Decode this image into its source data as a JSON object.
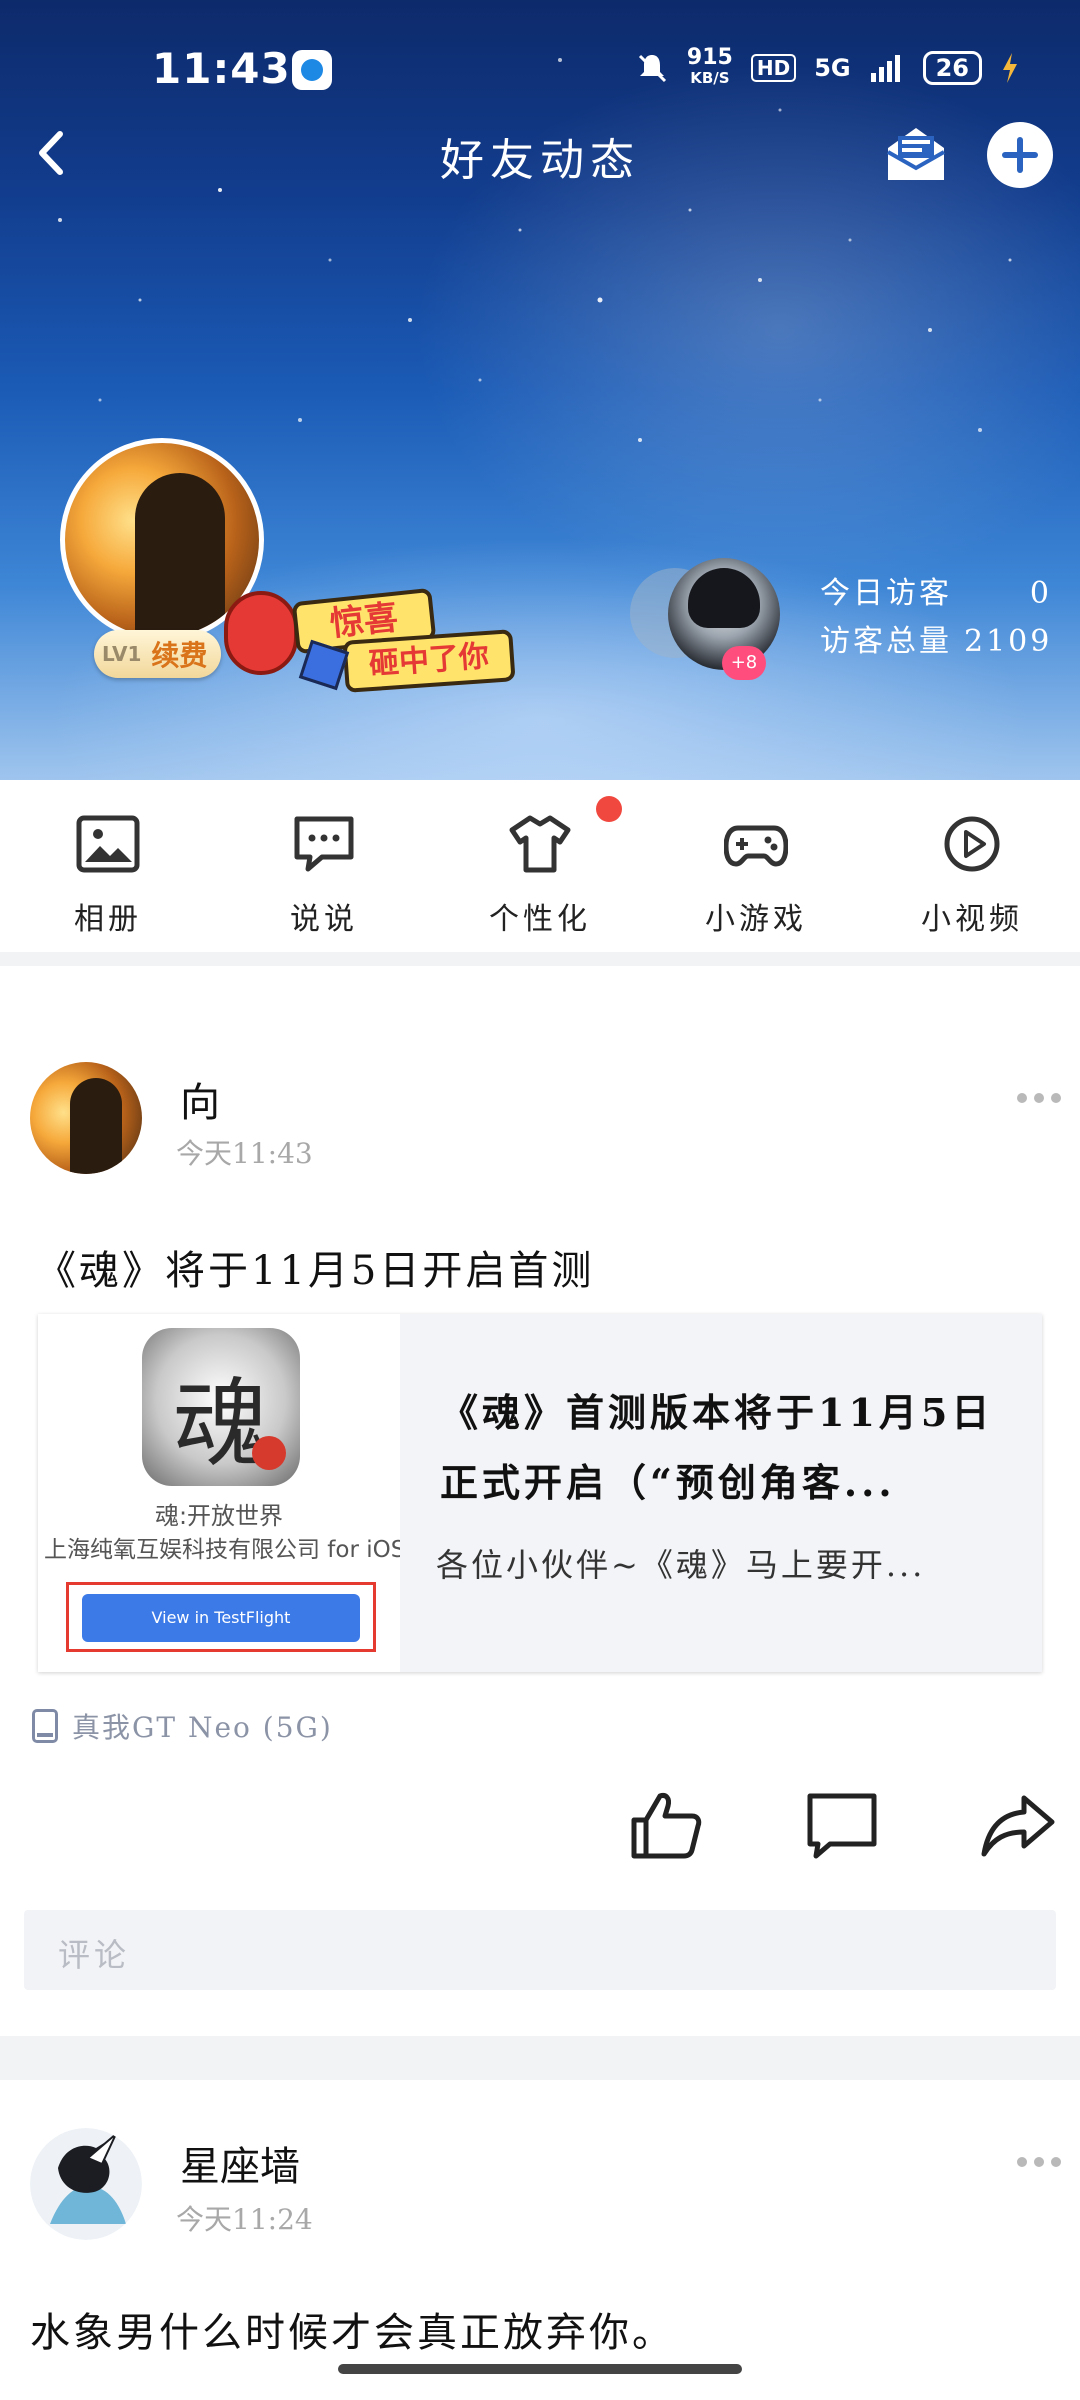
{
  "status_bar": {
    "time": "11:43",
    "net_speed": "915",
    "net_unit": "KB/S",
    "hd": "HD",
    "network": "5G",
    "battery": "26"
  },
  "header": {
    "title": "好友动态"
  },
  "profile": {
    "level": "LV1",
    "renew_label": "续费",
    "promo_line1": "惊喜",
    "promo_line2": "砸中了你",
    "visitor_extra": "+8",
    "today_visitors_label": "今日访客",
    "today_visitors_value": "0",
    "total_visitors_label": "访客总量",
    "total_visitors_value": "2109"
  },
  "shortcuts": [
    {
      "label": "相册",
      "icon": "photo-album-icon"
    },
    {
      "label": "说说",
      "icon": "chat-bubble-icon"
    },
    {
      "label": "个性化",
      "icon": "tshirt-icon"
    },
    {
      "label": "小游戏",
      "icon": "gamepad-icon"
    },
    {
      "label": "小视频",
      "icon": "play-circle-icon"
    }
  ],
  "posts": [
    {
      "author": "向",
      "time": "今天11:43",
      "text": "《魂》将于11月5日开启首测",
      "link": {
        "app_name": "魂:开放世界",
        "company": "上海纯氧互娱科技有限公司 for iOS",
        "button": "View in TestFlight",
        "title": "《魂》首测版本将于11月5日正式开启（“预创角客...",
        "desc": "各位小伙伴~《魂》马上要开..."
      },
      "device": "真我GT Neo (5G)",
      "comment_placeholder": "评论"
    },
    {
      "author": "星座墙",
      "time": "今天11:24",
      "text": "水象男什么时候才会真正放弃你。"
    }
  ],
  "colors": {
    "accent_red": "#f0483e",
    "link_blue": "#3c7ae8",
    "muted_text": "#a8a8a8"
  }
}
